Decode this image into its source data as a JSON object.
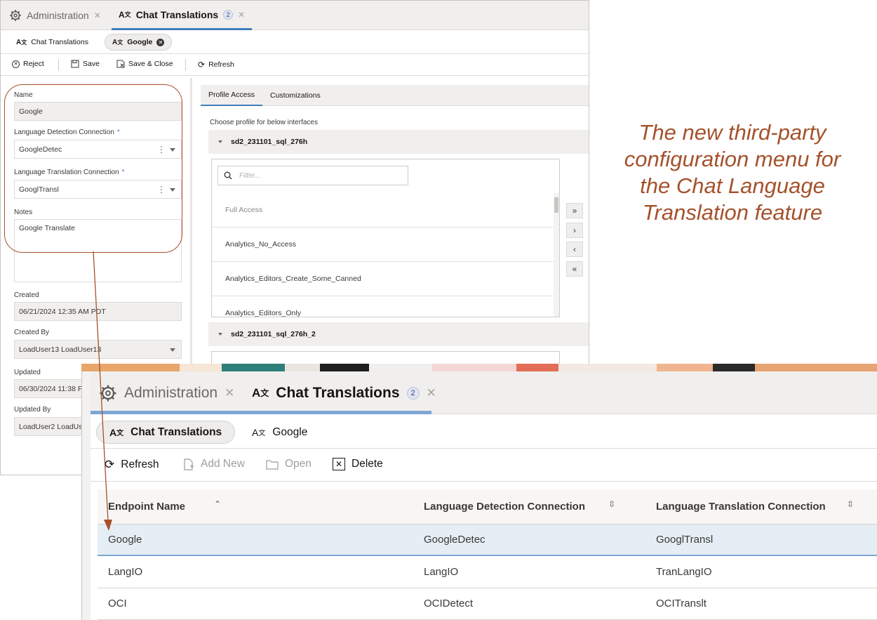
{
  "caption": {
    "line1": "The new third-party",
    "line2": "configuration menu for",
    "line3": "the Chat Language",
    "line4": "Translation feature"
  },
  "back_window": {
    "tabs": [
      {
        "label": "Administration",
        "icon": "gear-icon",
        "active": false
      },
      {
        "label": "Chat Translations",
        "icon": "translate-icon",
        "badge": "2",
        "active": true
      }
    ],
    "subtabs": [
      {
        "label": "Chat Translations",
        "icon": "translate-icon"
      },
      {
        "label": "Google",
        "icon": "translate-icon",
        "closable": true
      }
    ],
    "toolbar": {
      "reject": "Reject",
      "save": "Save",
      "save_close": "Save & Close",
      "refresh": "Refresh"
    },
    "form": {
      "name_label": "Name",
      "name_value": "Google",
      "detection_label": "Language Detection Connection",
      "detection_value": "GoogleDetec",
      "translation_label": "Language Translation Connection",
      "translation_value": "GooglTransl",
      "required_mark": "*",
      "notes_label": "Notes",
      "notes_value": "Google Translate",
      "created_label": "Created",
      "created_value": "06/21/2024 12:35 AM PDT",
      "created_by_label": "Created By",
      "created_by_value": "LoadUser13 LoadUser13",
      "updated_label": "Updated",
      "updated_value": "06/30/2024 11:38 P",
      "updated_by_label": "Updated By",
      "updated_by_value": "LoadUser2 LoadUse"
    },
    "right_tabs": [
      "Profile Access",
      "Customizations"
    ],
    "choose_text": "Choose profile for below interfaces",
    "groups": [
      "sd2_231101_sql_276h",
      "sd2_231101_sql_276h_2"
    ],
    "filter_placeholder": "Filter...",
    "profiles": [
      "Full Access",
      "Analytics_No_Access",
      "Analytics_Editors_Create_Some_Canned",
      "Analytics_Editors_Only"
    ],
    "move_buttons": [
      "»",
      "›",
      "‹",
      "«"
    ]
  },
  "front_window": {
    "tabs": [
      {
        "label": "Administration",
        "active": false
      },
      {
        "label": "Chat Translations",
        "badge": "2",
        "active": true
      }
    ],
    "subtabs": [
      {
        "label": "Chat Translations",
        "active": true
      },
      {
        "label": "Google",
        "active": false
      }
    ],
    "toolbar": {
      "refresh": "Refresh",
      "add_new": "Add New",
      "open": "Open",
      "delete": "Delete"
    },
    "columns": [
      "Endpoint Name",
      "Language Detection Connection",
      "Language Translation Connection"
    ],
    "rows": [
      [
        "Google",
        "GoogleDetec",
        "GooglTransl"
      ],
      [
        "LangIO",
        "LangIO",
        "TranLangIO"
      ],
      [
        "OCI",
        "OCIDetect",
        "OCITranslt"
      ]
    ],
    "selected_row": 0
  },
  "colors": {
    "accent": "#3f7ec0",
    "annotation": "#a5512b",
    "selected_row": "#e5eef5"
  }
}
